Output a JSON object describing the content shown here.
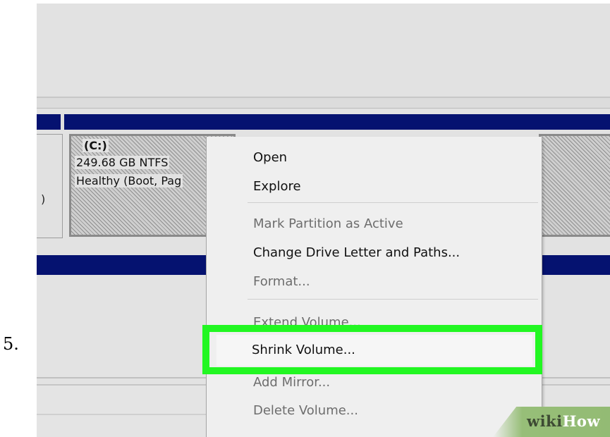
{
  "step": {
    "number": "5."
  },
  "disk0": {
    "label_fragment": ")"
  },
  "volume_c": {
    "name": "(C:)",
    "size": "249.68 GB NTFS",
    "status": "Healthy (Boot, Pag"
  },
  "context_menu": {
    "items": [
      {
        "label": "Open",
        "enabled": true
      },
      {
        "label": "Explore",
        "enabled": true
      },
      {
        "label": "Mark Partition as Active",
        "enabled": false
      },
      {
        "label": "Change Drive Letter and Paths...",
        "enabled": true
      },
      {
        "label": "Format...",
        "enabled": false
      },
      {
        "label": "Extend Volume...",
        "enabled": false
      },
      {
        "label": "Shrink Volume...",
        "enabled": true,
        "highlighted": true
      },
      {
        "label": "Add Mirror...",
        "enabled": false
      },
      {
        "label": "Delete Volume...",
        "enabled": false
      }
    ]
  },
  "watermark": {
    "part1": "wiki",
    "part2": "How"
  },
  "colors": {
    "disk_header": "#051270",
    "highlight": "#22f722",
    "watermark_bg": "#97be78"
  }
}
